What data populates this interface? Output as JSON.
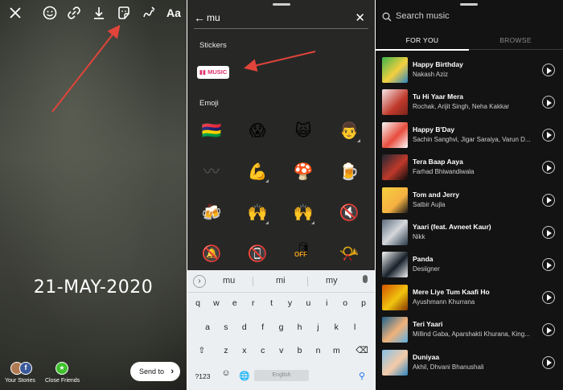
{
  "story": {
    "date_text": "21-MAY-2020",
    "text_tool_label": "Aa",
    "toolbar_icons": [
      "close-icon",
      "emoji-face-icon",
      "link-icon",
      "download-icon",
      "sticker-icon",
      "draw-icon"
    ],
    "your_stories_label": "Your Stories",
    "close_friends_label": "Close Friends",
    "send_to_label": "Send to"
  },
  "sticker_search": {
    "query": "mu",
    "stickers_heading": "Stickers",
    "music_sticker_label": "MUSIC",
    "emoji_heading": "Emoji",
    "emoji": [
      "🇲🇺",
      "😱",
      "🙀",
      "👨",
      "〰",
      "💪",
      "🍄",
      "🍺",
      "🍻",
      "🙌",
      "🙌",
      "🔇",
      "🔕",
      "📵",
      "🛢",
      "📯"
    ],
    "off_label": "OFF"
  },
  "keyboard": {
    "suggestions": [
      "mu",
      "mi",
      "my"
    ],
    "row1": [
      "q",
      "w",
      "e",
      "r",
      "t",
      "y",
      "u",
      "i",
      "o",
      "p"
    ],
    "row2": [
      "a",
      "s",
      "d",
      "f",
      "g",
      "h",
      "j",
      "k",
      "l"
    ],
    "row3": [
      "z",
      "x",
      "c",
      "v",
      "b",
      "n",
      "m"
    ],
    "symbols_key": "?123",
    "space_label": "English"
  },
  "music": {
    "search_placeholder": "Search music",
    "tabs": {
      "for_you": "FOR YOU",
      "browse": "BROWSE"
    },
    "songs": [
      {
        "title": "Happy Birthday",
        "artist": "Nakash Aziz"
      },
      {
        "title": "Tu Hi Yaar Mera",
        "artist": "Rochak, Arijit Singh, Neha Kakkar"
      },
      {
        "title": "Happy B'Day",
        "artist": "Sachin Sanghvi, Jigar Saraiya, Varun D..."
      },
      {
        "title": "Tera Baap Aaya",
        "artist": "Farhad Bhiwandiwala"
      },
      {
        "title": "Tom and Jerry",
        "artist": "Satbir Aujla"
      },
      {
        "title": "Yaari (feat. Avneet Kaur)",
        "artist": "Nikk"
      },
      {
        "title": "Panda",
        "artist": "Desiigner"
      },
      {
        "title": "Mere Liye Tum Kaafi Ho",
        "artist": "Ayushmann Khurrana"
      },
      {
        "title": "Teri Yaari",
        "artist": "Millind Gaba, Aparshakti Khurana, King..."
      },
      {
        "title": "Duniyaa",
        "artist": "Akhil, Dhvani Bhanushali"
      }
    ]
  },
  "colors": {
    "accent_green": "#3ec12c",
    "music_pink": "#e1306c",
    "annotation_red": "#e0443a"
  }
}
